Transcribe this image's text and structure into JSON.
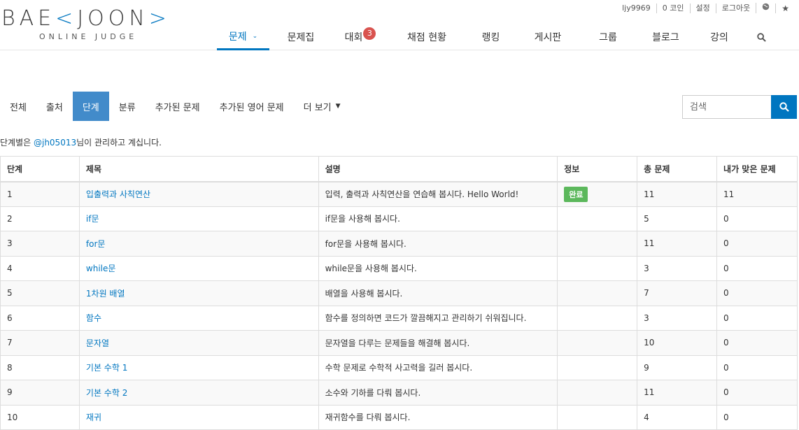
{
  "logo": {
    "brand_left": "BAE",
    "brand_mid": "JOON",
    "tagline": "ONLINE JUDGE"
  },
  "usernav": {
    "username": "ljy9969",
    "coins": "0 코인",
    "settings": "설정",
    "logout": "로그아웃"
  },
  "mainnav": [
    {
      "label": "문제"
    },
    {
      "label": "문제집"
    },
    {
      "label": "대회",
      "badge": "3"
    },
    {
      "label": "채점 현황"
    },
    {
      "label": "랭킹"
    },
    {
      "label": "게시판"
    },
    {
      "label": "그룹"
    },
    {
      "label": "블로그"
    },
    {
      "label": "강의"
    }
  ],
  "subtabs": [
    {
      "label": "전체"
    },
    {
      "label": "출처"
    },
    {
      "label": "단계"
    },
    {
      "label": "분류"
    },
    {
      "label": "추가된 문제"
    },
    {
      "label": "추가된 영어 문제"
    },
    {
      "label": "더 보기"
    }
  ],
  "search": {
    "placeholder": "검색"
  },
  "manager": {
    "prefix": "단계별은 ",
    "handle": "@jh05013",
    "suffix": "님이 관리하고 계십니다."
  },
  "table": {
    "headers": [
      "단계",
      "제목",
      "설명",
      "정보",
      "총 문제",
      "내가 맞은 문제"
    ],
    "rows": [
      {
        "step": "1",
        "title": "입출력과 사칙연산",
        "desc": "입력, 출력과 사칙연산을 연습해 봅시다. Hello World!",
        "info": "완료",
        "total": "11",
        "solved": "11"
      },
      {
        "step": "2",
        "title": "if문",
        "desc": "if문을 사용해 봅시다.",
        "info": "",
        "total": "5",
        "solved": "0"
      },
      {
        "step": "3",
        "title": "for문",
        "desc": "for문을 사용해 봅시다.",
        "info": "",
        "total": "11",
        "solved": "0"
      },
      {
        "step": "4",
        "title": "while문",
        "desc": "while문을 사용해 봅시다.",
        "info": "",
        "total": "3",
        "solved": "0"
      },
      {
        "step": "5",
        "title": "1차원 배열",
        "desc": "배열을 사용해 봅시다.",
        "info": "",
        "total": "7",
        "solved": "0"
      },
      {
        "step": "6",
        "title": "함수",
        "desc": "함수를 정의하면 코드가 깔끔해지고 관리하기 쉬워집니다.",
        "info": "",
        "total": "3",
        "solved": "0"
      },
      {
        "step": "7",
        "title": "문자열",
        "desc": "문자열을 다루는 문제들을 해결해 봅시다.",
        "info": "",
        "total": "10",
        "solved": "0"
      },
      {
        "step": "8",
        "title": "기본 수학 1",
        "desc": "수학 문제로 수학적 사고력을 길러 봅시다.",
        "info": "",
        "total": "9",
        "solved": "0"
      },
      {
        "step": "9",
        "title": "기본 수학 2",
        "desc": "소수와 기하를 다뤄 봅시다.",
        "info": "",
        "total": "11",
        "solved": "0"
      },
      {
        "step": "10",
        "title": "재귀",
        "desc": "재귀함수를 다뤄 봅시다.",
        "info": "",
        "total": "4",
        "solved": "0"
      }
    ]
  },
  "colors": {
    "accent": "#0076c0",
    "active_tab": "#428bca",
    "done": "#5cb85c",
    "badge": "#d9534f"
  }
}
